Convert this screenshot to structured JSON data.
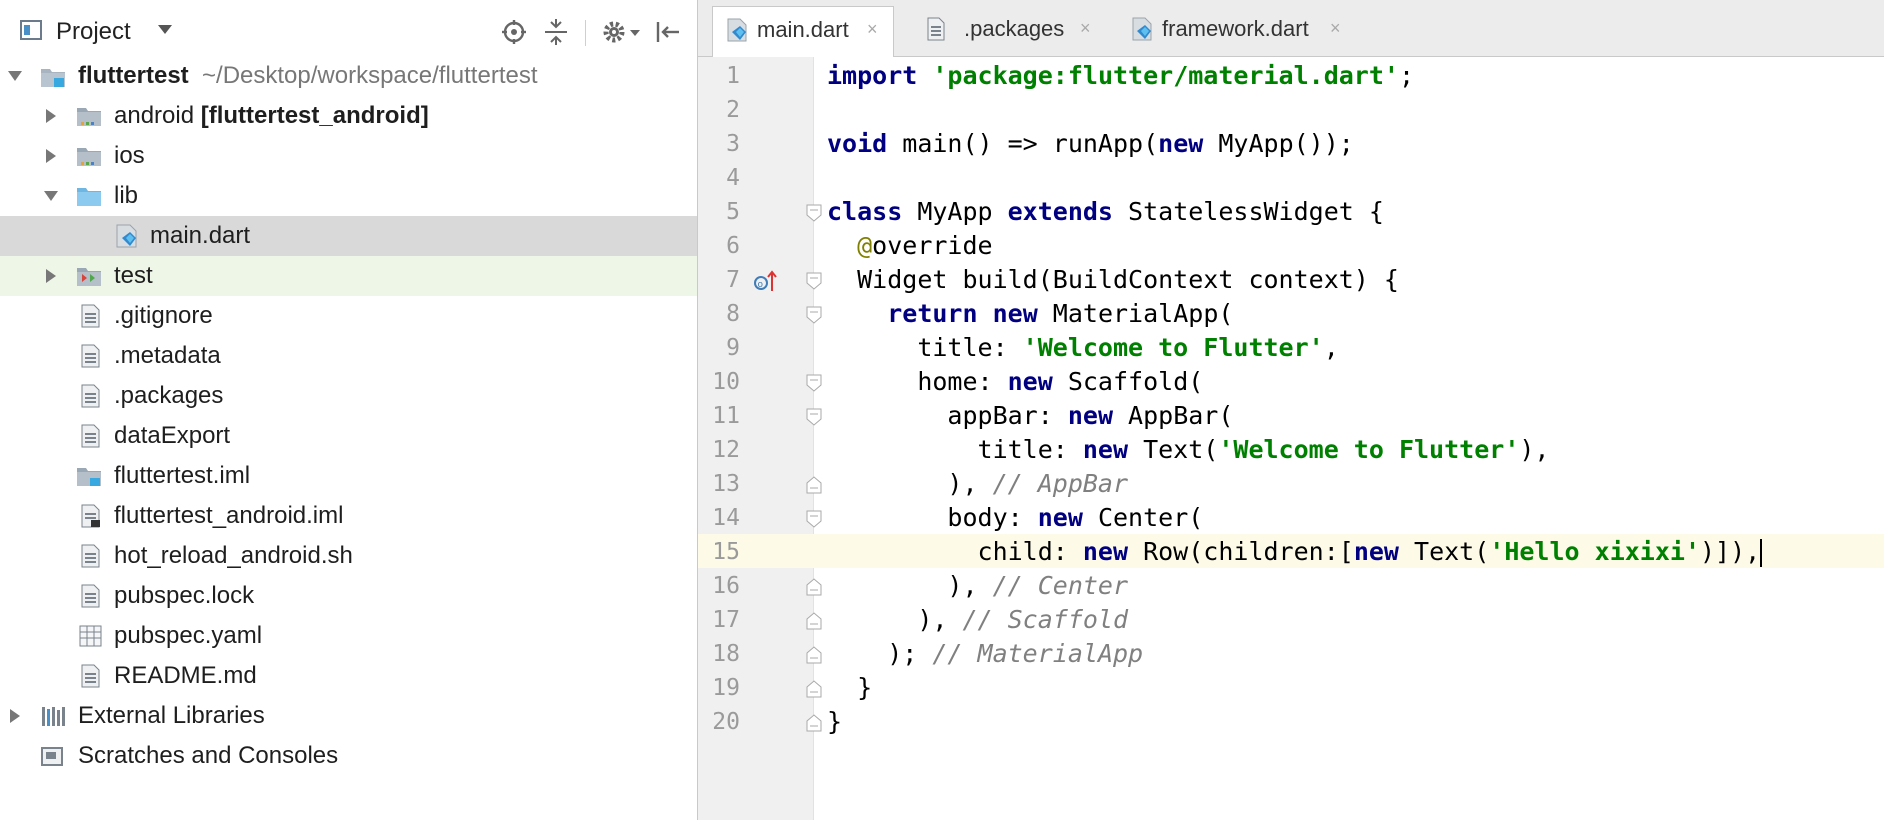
{
  "project_panel": {
    "title": "Project",
    "tree": [
      {
        "label": "fluttertest",
        "suffix": "~/Desktop/workspace/fluttertest",
        "icon": "module-folder-icon",
        "expanded": true
      },
      {
        "label": "android",
        "suffix": "[fluttertest_android]",
        "icon": "folder-icon",
        "expanded": false
      },
      {
        "label": "ios",
        "icon": "folder-icon",
        "expanded": false
      },
      {
        "label": "lib",
        "icon": "folder-icon",
        "expanded": true
      },
      {
        "label": "main.dart",
        "icon": "dart-file-icon",
        "selected": true
      },
      {
        "label": "test",
        "icon": "test-folder-icon",
        "expanded": false
      },
      {
        "label": ".gitignore",
        "icon": "text-file-icon"
      },
      {
        "label": ".metadata",
        "icon": "text-file-icon"
      },
      {
        "label": ".packages",
        "icon": "text-file-icon"
      },
      {
        "label": "dataExport",
        "icon": "text-file-icon"
      },
      {
        "label": "fluttertest.iml",
        "icon": "module-file-icon"
      },
      {
        "label": "fluttertest_android.iml",
        "icon": "module-file-icon"
      },
      {
        "label": "hot_reload_android.sh",
        "icon": "text-file-icon"
      },
      {
        "label": "pubspec.lock",
        "icon": "text-file-icon"
      },
      {
        "label": "pubspec.yaml",
        "icon": "yaml-file-icon"
      },
      {
        "label": "README.md",
        "icon": "text-file-icon"
      },
      {
        "label": "External Libraries",
        "icon": "libraries-icon",
        "expanded": false
      },
      {
        "label": "Scratches and Consoles",
        "icon": "scratches-icon"
      }
    ]
  },
  "editor": {
    "tabs": [
      {
        "label": "main.dart",
        "close": "×",
        "active": true
      },
      {
        "label": ".packages",
        "close": "×"
      },
      {
        "label": "framework.dart",
        "close": "×"
      }
    ],
    "line_numbers": [
      "1",
      "2",
      "3",
      "4",
      "5",
      "6",
      "7",
      "8",
      "9",
      "10",
      "11",
      "12",
      "13",
      "14",
      "15",
      "16",
      "17",
      "18",
      "19",
      "20"
    ],
    "current_line": "15",
    "code": {
      "l1": {
        "kw": "import",
        "str": "'package:flutter/material.dart'",
        "rest": ";"
      },
      "l3": {
        "kw1": "void",
        "mid": " main() => runApp(",
        "kw2": "new",
        "rest": " MyApp());"
      },
      "l5": {
        "kw1": "class",
        "mid": " MyApp ",
        "kw2": "extends",
        "rest": " StatelessWidget {"
      },
      "l6": {
        "ann": "@",
        "rest": "override"
      },
      "l7": {
        "text": "Widget build(BuildContext context) {"
      },
      "l8": {
        "kw1": "return",
        "sp": " ",
        "kw2": "new",
        "rest": " MaterialApp("
      },
      "l9": {
        "pre": "title: ",
        "str": "'Welcome to Flutter'",
        "rest": ","
      },
      "l10": {
        "pre": "home: ",
        "kw": "new",
        "rest": " Scaffold("
      },
      "l11": {
        "pre": "appBar: ",
        "kw": "new",
        "rest": " AppBar("
      },
      "l12": {
        "pre": "title: ",
        "kw": "new",
        "mid": " Text(",
        "str": "'Welcome to Flutter'",
        "rest": "),"
      },
      "l13": {
        "pre": "), ",
        "cm": "// AppBar"
      },
      "l14": {
        "pre": "body: ",
        "kw": "new",
        "rest": " Center("
      },
      "l15": {
        "pre": "child: ",
        "kw1": "new",
        "mid1": " Row(children:[",
        "kw2": "new",
        "mid2": " Text(",
        "str": "'Hello xixixi'",
        "rest": ")]),"
      },
      "l16": {
        "pre": "), ",
        "cm": "// Center"
      },
      "l17": {
        "pre": "), ",
        "cm": "// Scaffold"
      },
      "l18": {
        "pre": "); ",
        "cm": "// MaterialApp"
      },
      "l19": {
        "text": "}"
      },
      "l20": {
        "text": "}"
      }
    },
    "gutter_marker_icon": "override-method-icon"
  },
  "colors": {
    "keyword": "#000080",
    "string": "#008000",
    "comment": "#808080",
    "annotation": "#808000",
    "selected_row": "#d9d9d9",
    "current_line": "#fdfbe7"
  }
}
